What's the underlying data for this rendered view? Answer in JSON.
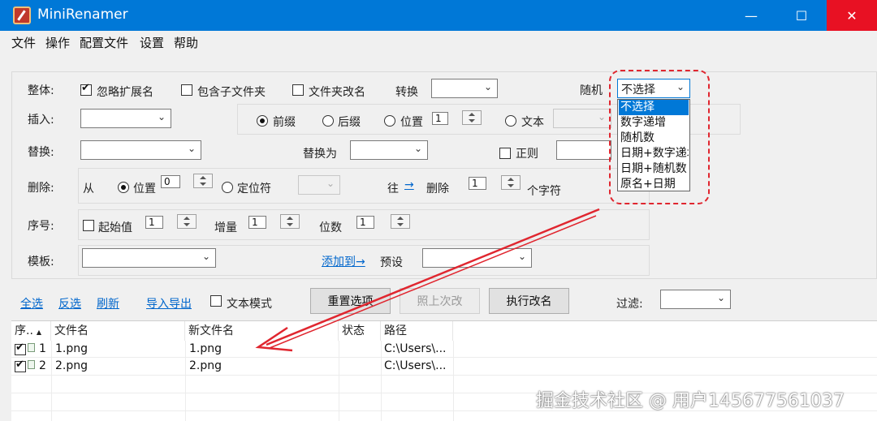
{
  "window": {
    "title": "MiniRenamer",
    "min_glyph": "—",
    "max_glyph": "☐",
    "close_glyph": "✕"
  },
  "menu": [
    "文件",
    "操作",
    "配置文件",
    "设置",
    "帮助"
  ],
  "options": {
    "whole": {
      "label": "整体:",
      "ignore_ext": "忽略扩展名",
      "include_sub": "包含子文件夹",
      "folder_rename": "文件夹改名",
      "convert": "转换",
      "random": "随机",
      "random_selected": "不选择"
    },
    "insert": {
      "label": "插入:",
      "prefix": "前缀",
      "suffix": "后缀",
      "position": "位置",
      "position_value": "1",
      "text": "文本"
    },
    "replace": {
      "label": "替换:",
      "replace_with": "替换为",
      "regex": "正则"
    },
    "delete": {
      "label": "删除:",
      "from": "从",
      "position": "位置",
      "position_value": "0",
      "locator": "定位符",
      "to": "往",
      "arrow": "→",
      "delete": "删除",
      "count_value": "1",
      "chars": "个字符"
    },
    "sequence": {
      "label": "序号:",
      "start": "起始值",
      "start_value": "1",
      "increment": "增量",
      "increment_value": "1",
      "digits": "位数",
      "digits_value": "1"
    },
    "template": {
      "label": "模板:",
      "add_to": "添加到→",
      "preset": "预设"
    }
  },
  "random_dropdown": [
    "不选择",
    "数字递增",
    "随机数",
    "日期+数字递增",
    "日期+随机数",
    "原名+日期"
  ],
  "toolbar": {
    "select_all": "全选",
    "invert": "反选",
    "refresh": "刷新",
    "import_export": "导入导出",
    "text_mode": "文本模式",
    "reset": "重置选项",
    "undo_last": "照上次改",
    "execute": "执行改名",
    "filter": "过滤:"
  },
  "list": {
    "columns": [
      "序..",
      "文件名",
      "新文件名",
      "状态",
      "路径"
    ],
    "sort_glyph": "▲",
    "rows": [
      {
        "index": "1",
        "filename": "1.png",
        "new_filename": "1.png",
        "status": "",
        "path": "C:\\Users\\..."
      },
      {
        "index": "2",
        "filename": "2.png",
        "new_filename": "2.png",
        "status": "",
        "path": "C:\\Users\\..."
      }
    ]
  },
  "watermark": "掘金技术社区 @ 用户145677561037",
  "colors": {
    "titlebar": "#0078d7",
    "close": "#e81123",
    "link": "#0066cc",
    "highlight": "#e0262f",
    "arrow": "#e0262f"
  }
}
